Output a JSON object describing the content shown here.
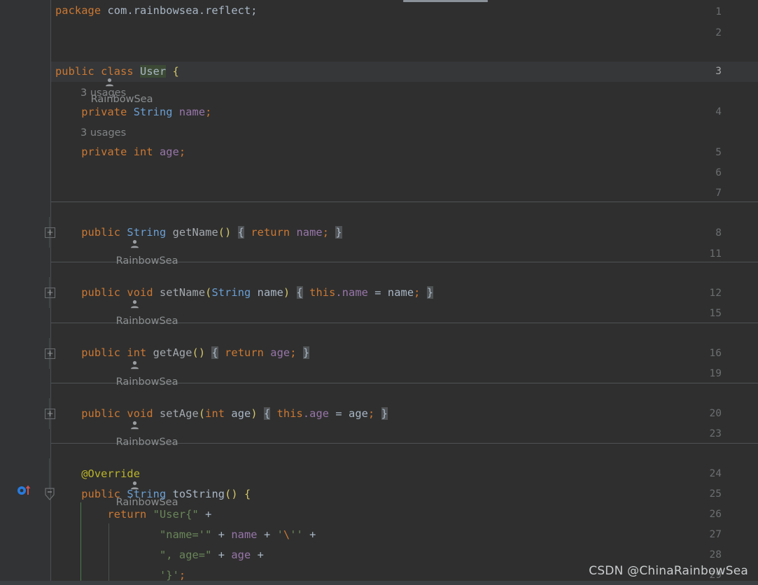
{
  "editor": {
    "theme": "darcula",
    "background": "#2f2f2f",
    "gutter_background": "#313335",
    "current_line_background": "#353739",
    "separator_color": "#4e5254",
    "current_line_number": "3"
  },
  "colors": {
    "keyword": "#cc7832",
    "plain": "#a9b7c6",
    "type": "#6a9fd4",
    "method_decl": "#a2a8ad",
    "field": "#9876aa",
    "string": "#6a8759",
    "annotation": "#bbb529",
    "brace": "#d4c76a",
    "class_name_highlight_bg": "#3c4a35",
    "brace_highlight_bg": "#505355",
    "line_number": "#6b6e70",
    "inlay_hint": "#808385",
    "indent_guide": "#4b4f51",
    "active_indent_guide": "#4e7a4e",
    "override_icon": "#287bde",
    "override_arrow": "#c75450"
  },
  "gutter": {
    "line_numbers": [
      "1",
      "2",
      "3",
      "4",
      "5",
      "6",
      "7",
      "8",
      "11",
      "12",
      "15",
      "16",
      "19",
      "20",
      "23",
      "24",
      "25",
      "26",
      "27",
      "28",
      "29"
    ],
    "fold_markers": [
      {
        "line": "8",
        "glyph": "+"
      },
      {
        "line": "12",
        "glyph": "+"
      },
      {
        "line": "16",
        "glyph": "+"
      },
      {
        "line": "20",
        "glyph": "+"
      },
      {
        "line": "25",
        "glyph": "-"
      }
    ],
    "override_marker_line": "25",
    "override_marker_tooltip": "Overrides method in Object"
  },
  "inlay_hints": {
    "author_label": "RainbowSea",
    "usages_name": "3 usages",
    "usages_age": "3 usages"
  },
  "code": {
    "lines": [
      {
        "n": "1",
        "text": "package com.rainbowsea.reflect;"
      },
      {
        "n": "2",
        "text": ""
      },
      {
        "n": "3",
        "text": "public class User {"
      },
      {
        "n": "4",
        "text": "    private String name;"
      },
      {
        "n": "5",
        "text": "    private int age;"
      },
      {
        "n": "6",
        "text": ""
      },
      {
        "n": "7",
        "text": ""
      },
      {
        "n": "8",
        "text": "    public String getName() { return name; }"
      },
      {
        "n": "11",
        "text": ""
      },
      {
        "n": "12",
        "text": "    public void setName(String name) { this.name = name; }"
      },
      {
        "n": "15",
        "text": ""
      },
      {
        "n": "16",
        "text": "    public int getAge() { return age; }"
      },
      {
        "n": "19",
        "text": ""
      },
      {
        "n": "20",
        "text": "    public void setAge(int age) { this.age = age; }"
      },
      {
        "n": "23",
        "text": ""
      },
      {
        "n": "24",
        "text": "    @Override"
      },
      {
        "n": "25",
        "text": "    public String toString() {"
      },
      {
        "n": "26",
        "text": "        return \"User{\" +"
      },
      {
        "n": "27",
        "text": "                \"name='\" + name + '\\'' +"
      },
      {
        "n": "28",
        "text": "                \", age=\" + age +"
      },
      {
        "n": "29",
        "text": "                '}';"
      }
    ],
    "tokens": {
      "l1_package": "package",
      "l1_pkgname": " com.rainbowsea.reflect;",
      "l3_public": "public",
      "l3_class": "class",
      "l3_user": "User",
      "l3_brace": "{",
      "l4_private": "private",
      "l4_String": "String",
      "l4_name": "name",
      "l4_semi": ";",
      "l5_private": "private",
      "l5_int": "int",
      "l5_age": "age",
      "l5_semi": ";",
      "l8_public": "public",
      "l8_String": "String",
      "l8_getName": "getName",
      "l8_parens": "()",
      "l8_open": "{",
      "l8_return": "return",
      "l8_name": "name",
      "l8_semi": ";",
      "l8_close": "}",
      "l12_public": "public",
      "l12_void": "void",
      "l12_setName": "setName",
      "l12_lparen": "(",
      "l12_String": "String",
      "l12_param": "name",
      "l12_rparen": ")",
      "l12_open": "{",
      "l12_this": "this",
      "l12_dot_name": ".name",
      "l12_eq": "=",
      "l12_name": "name",
      "l12_semi": ";",
      "l12_close": "}",
      "l16_public": "public",
      "l16_int": "int",
      "l16_getAge": "getAge",
      "l16_parens": "()",
      "l16_open": "{",
      "l16_return": "return",
      "l16_age": "age",
      "l16_semi": ";",
      "l16_close": "}",
      "l20_public": "public",
      "l20_void": "void",
      "l20_setAge": "setAge",
      "l20_lparen": "(",
      "l20_int": "int",
      "l20_param": "age",
      "l20_rparen": ")",
      "l20_open": "{",
      "l20_this": "this",
      "l20_dot_age": ".age",
      "l20_eq": "=",
      "l20_age": "age",
      "l20_semi": ";",
      "l20_close": "}",
      "l24_override": "@Override",
      "l25_public": "public",
      "l25_String": "String",
      "l25_toString": "toString",
      "l25_parens": "()",
      "l25_brace": "{",
      "l26_return": "return",
      "l26_str": "\"User{\"",
      "l26_plus": "+",
      "l27_str": "\"name='\"",
      "l27_plus1": "+",
      "l27_name": "name",
      "l27_plus2": "+",
      "l27_q1": "'",
      "l27_esc": "\\",
      "l27_q2": "''",
      "l27_plus3": "+",
      "l28_str": "\", age=\"",
      "l28_plus1": "+",
      "l28_age": "age",
      "l28_plus2": "+",
      "l29_char": "'}'",
      "l29_semi": ";"
    }
  },
  "watermark": {
    "text": "CSDN @ChinaRainbowSea"
  }
}
